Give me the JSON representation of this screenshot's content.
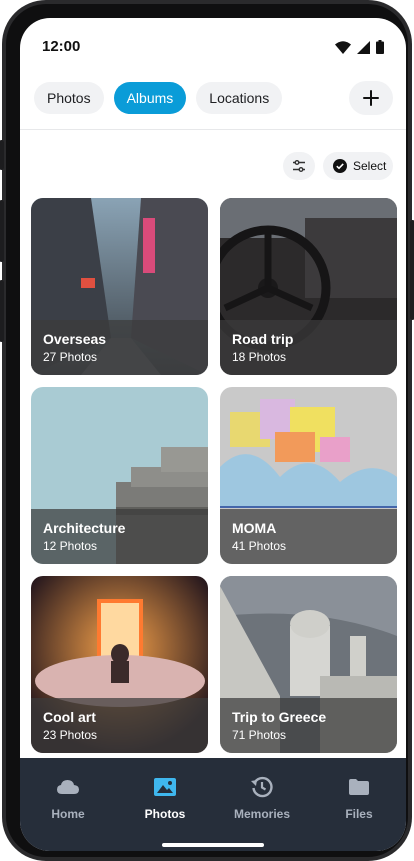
{
  "status_bar": {
    "time": "12:00"
  },
  "tabs": [
    {
      "label": "Photos",
      "active": false
    },
    {
      "label": "Albums",
      "active": true
    },
    {
      "label": "Locations",
      "active": false
    }
  ],
  "toolbar": {
    "select_label": "Select"
  },
  "albums": [
    {
      "title": "Overseas",
      "count": "27 Photos"
    },
    {
      "title": "Road trip",
      "count": "18 Photos"
    },
    {
      "title": "Architecture",
      "count": "12 Photos"
    },
    {
      "title": "MOMA",
      "count": "41 Photos"
    },
    {
      "title": "Cool art",
      "count": "23 Photos"
    },
    {
      "title": "Trip to Greece",
      "count": "71 Photos"
    }
  ],
  "bottom_nav": [
    {
      "label": "Home",
      "icon": "cloud-icon",
      "active": false
    },
    {
      "label": "Photos",
      "icon": "image-icon",
      "active": true
    },
    {
      "label": "Memories",
      "icon": "history-icon",
      "active": false
    },
    {
      "label": "Files",
      "icon": "folder-icon",
      "active": false
    }
  ],
  "colors": {
    "accent": "#0a9cd8",
    "nav_background": "#262e3a"
  }
}
